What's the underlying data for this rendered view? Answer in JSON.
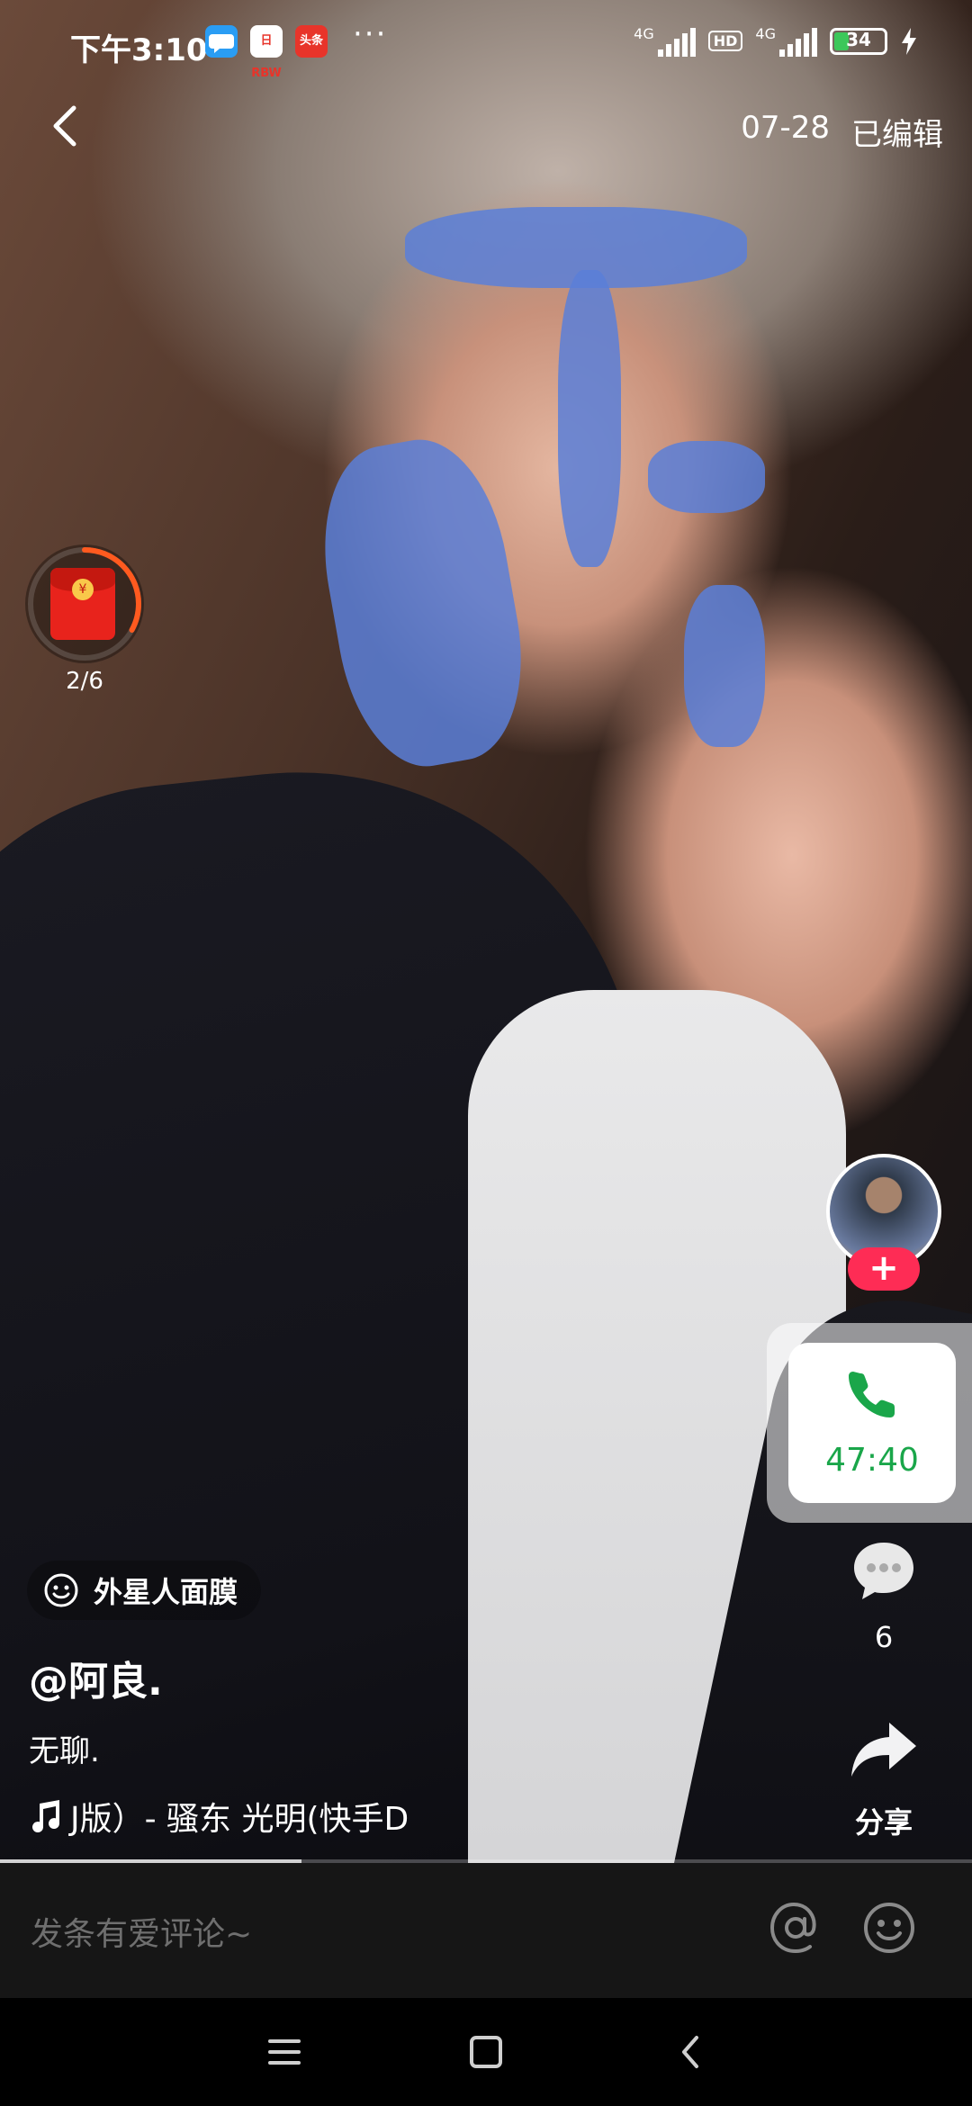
{
  "status_bar": {
    "time": "下午3:10",
    "app_icons": [
      {
        "name": "chat-app-icon",
        "color": "#2a9df4",
        "text": ""
      },
      {
        "name": "news-app-icon",
        "color": "#ffffff",
        "text": "日RBW"
      },
      {
        "name": "toutiao-icon",
        "color": "#e8342a",
        "text": "头条"
      }
    ],
    "more": "···",
    "network_1": "4G",
    "hd_badge": "HD",
    "network_2": "4G",
    "battery_level": "34",
    "battery_percent": 34,
    "charging_icon": "lightning-icon"
  },
  "top_bar": {
    "back_icon": "chevron-left-icon",
    "date": "07-28",
    "edited_label": "已编辑"
  },
  "red_packet": {
    "progress_text": "2/6",
    "progress_fraction": 0.33,
    "ring_color": "#ff5a1f"
  },
  "creator": {
    "follow_label": "+"
  },
  "call_card": {
    "duration": "47:40",
    "accent": "#1aa64a"
  },
  "actions": {
    "comment_count": "6",
    "share_label": "分享"
  },
  "video_info": {
    "effect_name": "外星人面膜",
    "username": "@阿良.",
    "caption": "无聊.",
    "music": "J版）- 骚东    光明(快手D"
  },
  "playback": {
    "progress_fraction": 0.31
  },
  "comment_bar": {
    "placeholder": "发条有爱评论~"
  },
  "colors": {
    "follow": "#fe2c55",
    "comment_bar_bg": "#161616"
  }
}
